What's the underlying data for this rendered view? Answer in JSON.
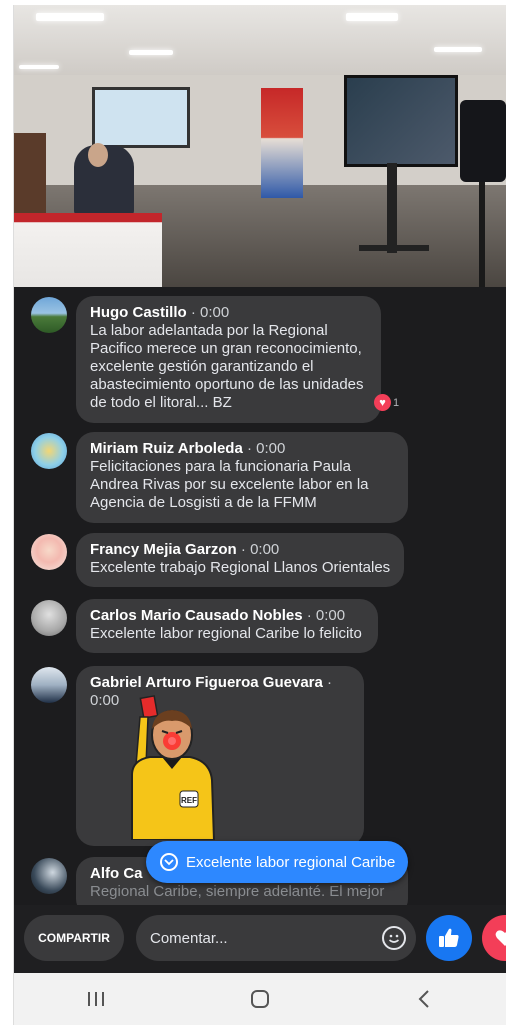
{
  "video": {},
  "comments": [
    {
      "name": "Hugo Castillo",
      "time": "0:00",
      "text": "La labor adelantada por la Regional Pacifico merece un gran reconocimiento, excelente gestión garantizando el abastecimiento oportuno de las unidades de todo el litoral... BZ",
      "reaction_count": "1"
    },
    {
      "name": "Miriam Ruiz Arboleda",
      "time": "0:00",
      "text": "Felicitaciones para  la funcionaria Paula Andrea  Rivas por su excelente labor en la Agencia de Losgisti a de la FFMM"
    },
    {
      "name": "Francy Mejia Garzon",
      "time": "0:00",
      "text": "Excelente trabajo Regional Llanos Orientales"
    },
    {
      "name": "Carlos Mario Causado Nobles",
      "time": "0:00",
      "text": "Excelente labor regional Caribe lo felicito"
    },
    {
      "name": "Gabriel Arturo Figueroa Guevara",
      "time": "0:00",
      "text": ""
    },
    {
      "name": "Alfo Ca",
      "time": "",
      "text": "Regional Caribe, siempre adelanté. El mejor"
    }
  ],
  "time_separator": " · ",
  "sticker": {
    "badge_text": "REF"
  },
  "new_comment_pill": {
    "label": "Excelente labor regional Caribe",
    "icon": "chevron-down-icon"
  },
  "bottom_bar": {
    "share_label": "COMPARTIR",
    "comment_placeholder": "Comentar...",
    "emoji_icon": "smiley-icon",
    "like_icon": "thumbs-up-icon",
    "love_icon": "heart-icon"
  },
  "navbar": {
    "recents": "|||",
    "home": "○",
    "back": "<"
  },
  "colors": {
    "accent": "#2d88ff",
    "like": "#1877f2",
    "love": "#f33e58",
    "bubble": "#3a3a3c",
    "background": "#1c1c1e"
  }
}
